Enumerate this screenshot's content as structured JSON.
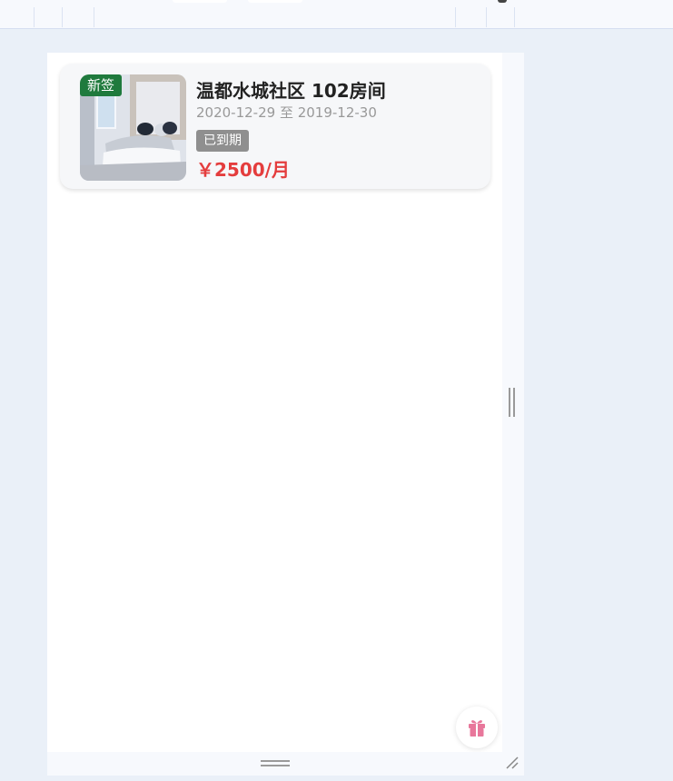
{
  "card": {
    "badge": "新签",
    "title": "温都水城社区 102房间",
    "date_range": "2020-12-29 至 2019-12-30",
    "status": "已到期",
    "price": "￥2500/月",
    "thumbnail_icon": "bedroom-photo"
  },
  "floating_button": {
    "icon": "gift-icon"
  },
  "colors": {
    "badge_green": "#1f7a3d",
    "status_gray": "#8f8f8f",
    "price_red": "#e43d3d",
    "gift_pink": "#e8779b",
    "background": "#eaf0f8"
  }
}
